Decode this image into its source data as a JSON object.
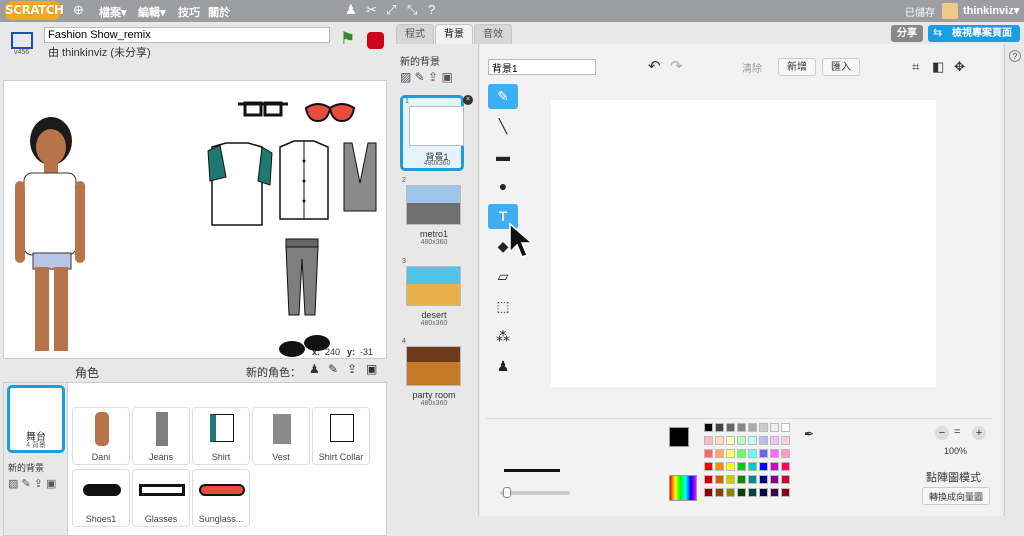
{
  "menubar": {
    "logo": "SCRATCH",
    "file": "檔案▾",
    "edit": "編輯▾",
    "tips": "技巧",
    "about": "關於",
    "saved": "已儲存",
    "user": "thinkinviz▾"
  },
  "project": {
    "title": "Fashion Show_remix",
    "author": "由 thinkinviz (未分享)",
    "version": "v456"
  },
  "share": {
    "share_label": "分享",
    "view_label": "檢視專案頁面"
  },
  "stage": {
    "x_label": "x:",
    "x_value": "240",
    "y_label": "y:",
    "y_value": "-31"
  },
  "sprites": {
    "header": "角色",
    "new_sprite": "新的角色：",
    "stage_tile": {
      "name": "舞台",
      "sub": "4 背景"
    },
    "new_backdrop": "新的背景",
    "items": [
      {
        "name": "Dani"
      },
      {
        "name": "Jeans"
      },
      {
        "name": "Shirt"
      },
      {
        "name": "Vest"
      },
      {
        "name": "Shirt Collar"
      },
      {
        "name": "Shoes1"
      },
      {
        "name": "Glasses"
      },
      {
        "name": "Sunglass..."
      }
    ]
  },
  "tabs": {
    "code": "程式",
    "backdrops": "背景",
    "sounds": "音效"
  },
  "backdrops": {
    "new_label": "新的背景",
    "items": [
      {
        "index": "1",
        "name": "背景1",
        "size": "480x360"
      },
      {
        "index": "2",
        "name": "metro1",
        "size": "480x360"
      },
      {
        "index": "3",
        "name": "desert",
        "size": "480x360"
      },
      {
        "index": "4",
        "name": "party room",
        "size": "480x360"
      }
    ]
  },
  "editor": {
    "name_value": "背景1",
    "clear": "清除",
    "add": "新增",
    "import": "匯入",
    "zoom": "100%",
    "mode": "點陣圖模式",
    "convert": "轉換成向量圖"
  },
  "colors": {
    "accent": "#1a9ee0",
    "selected": "#3faef2",
    "topbar": "#9c9ea2"
  }
}
